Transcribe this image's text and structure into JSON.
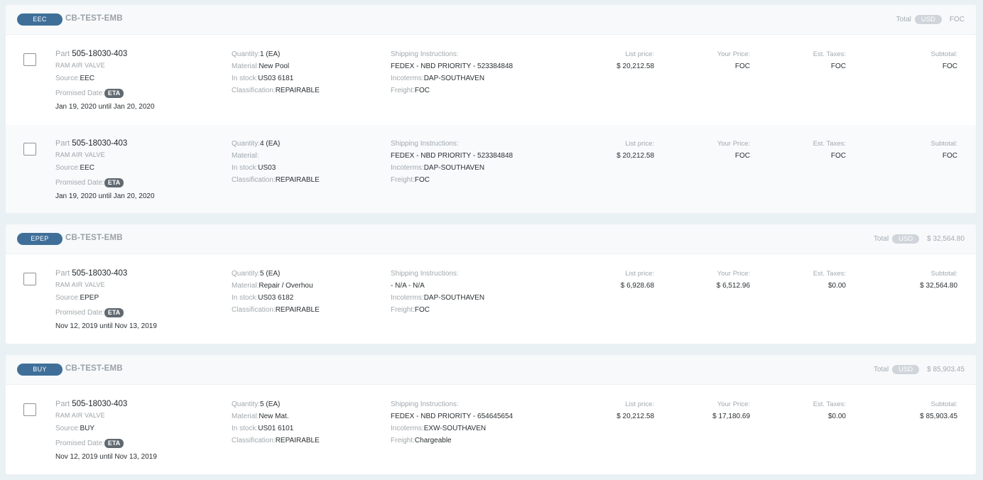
{
  "groups": [
    {
      "source": "EEC",
      "name": "CB-TEST-EMB",
      "total_label": "Total",
      "currency": "USD",
      "total_amount": "FOC",
      "rows": [
        {
          "part_label": "Part",
          "part_number": "505-18030-403",
          "description": "RAM AIR VALVE",
          "source_label": "Source:",
          "source": "EEC",
          "promised_label": "Promised Date:",
          "eta": "ETA",
          "date_range": "Jan 19, 2020 until Jan 20, 2020",
          "quantity_label": "Quantity:",
          "quantity": "1 (EA)",
          "material_label": "Material:",
          "material": "New Pool",
          "stock_label": "In stock:",
          "stock": "US03 6181",
          "classification_label": "Classification:",
          "classification": "REPAIRABLE",
          "shipping_label": "Shipping Instructions:",
          "shipping": "FEDEX - NBD PRIORITY - 523384848",
          "incoterms_label": "Incoterms:",
          "incoterms": "DAP-SOUTHAVEN",
          "freight_label": "Freight:",
          "freight": "FOC",
          "list_price_label": "List price:",
          "list_price": "$ 20,212.58",
          "your_price_label": "Your Price:",
          "your_price": "FOC",
          "taxes_label": "Est. Taxes:",
          "taxes": "FOC",
          "subtotal_label": "Subtotal:",
          "subtotal": "FOC"
        },
        {
          "part_label": "Part",
          "part_number": "505-18030-403",
          "description": "RAM AIR VALVE",
          "source_label": "Source:",
          "source": "EEC",
          "promised_label": "Promised Date:",
          "eta": "ETA",
          "date_range": "Jan 19, 2020 until Jan 20, 2020",
          "quantity_label": "Quantity:",
          "quantity": "4 (EA)",
          "material_label": "Material:",
          "material": "",
          "stock_label": "In stock:",
          "stock": "US03",
          "classification_label": "Classification:",
          "classification": "REPAIRABLE",
          "shipping_label": "Shipping Instructions:",
          "shipping": "FEDEX - NBD PRIORITY - 523384848",
          "incoterms_label": "Incoterms:",
          "incoterms": "DAP-SOUTHAVEN",
          "freight_label": "Freight:",
          "freight": "FOC",
          "list_price_label": "List price:",
          "list_price": "$ 20,212.58",
          "your_price_label": "Your Price:",
          "your_price": "FOC",
          "taxes_label": "Est. Taxes:",
          "taxes": "FOC",
          "subtotal_label": "Subtotal:",
          "subtotal": "FOC"
        }
      ]
    },
    {
      "source": "EPEP",
      "name": "CB-TEST-EMB",
      "total_label": "Total",
      "currency": "USD",
      "total_amount": "$ 32,564.80",
      "rows": [
        {
          "part_label": "Part",
          "part_number": "505-18030-403",
          "description": "RAM AIR VALVE",
          "source_label": "Source:",
          "source": "EPEP",
          "promised_label": "Promised Date:",
          "eta": "ETA",
          "date_range": "Nov 12, 2019 until Nov 13, 2019",
          "quantity_label": "Quantity:",
          "quantity": "5 (EA)",
          "material_label": "Material:",
          "material": "Repair / Overhou",
          "stock_label": "In stock:",
          "stock": "US03 6182",
          "classification_label": "Classification:",
          "classification": "REPAIRABLE",
          "shipping_label": "Shipping Instructions:",
          "shipping": "- N/A - N/A",
          "incoterms_label": "Incoterms:",
          "incoterms": "DAP-SOUTHAVEN",
          "freight_label": "Freight:",
          "freight": "FOC",
          "list_price_label": "List price:",
          "list_price": "$ 6,928.68",
          "your_price_label": "Your Price:",
          "your_price": "$ 6,512.96",
          "taxes_label": "Est. Taxes:",
          "taxes": "$0.00",
          "subtotal_label": "Subtotal:",
          "subtotal": "$ 32,564.80"
        }
      ]
    },
    {
      "source": "BUY",
      "name": "CB-TEST-EMB",
      "total_label": "Total",
      "currency": "USD",
      "total_amount": "$ 85,903.45",
      "rows": [
        {
          "part_label": "Part",
          "part_number": "505-18030-403",
          "description": "RAM AIR VALVE",
          "source_label": "Source:",
          "source": "BUY",
          "promised_label": "Promised Date:",
          "eta": "ETA",
          "date_range": "Nov 12, 2019 until Nov 13, 2019",
          "quantity_label": "Quantity:",
          "quantity": "5 (EA)",
          "material_label": "Material:",
          "material": "New Mat.",
          "stock_label": "In stock:",
          "stock": "US01 6101",
          "classification_label": "Classification:",
          "classification": "REPAIRABLE",
          "shipping_label": "Shipping Instructions:",
          "shipping": "FEDEX - NBD PRIORITY - 654645654",
          "incoterms_label": "Incoterms:",
          "incoterms": "EXW-SOUTHAVEN",
          "freight_label": "Freight:",
          "freight": "Chargeable",
          "list_price_label": "List price:",
          "list_price": "$ 20,212.58",
          "your_price_label": "Your Price:",
          "your_price": "$ 17,180.69",
          "taxes_label": "Est. Taxes:",
          "taxes": "$0.00",
          "subtotal_label": "Subtotal:",
          "subtotal": "$ 85,903.45"
        }
      ]
    }
  ]
}
